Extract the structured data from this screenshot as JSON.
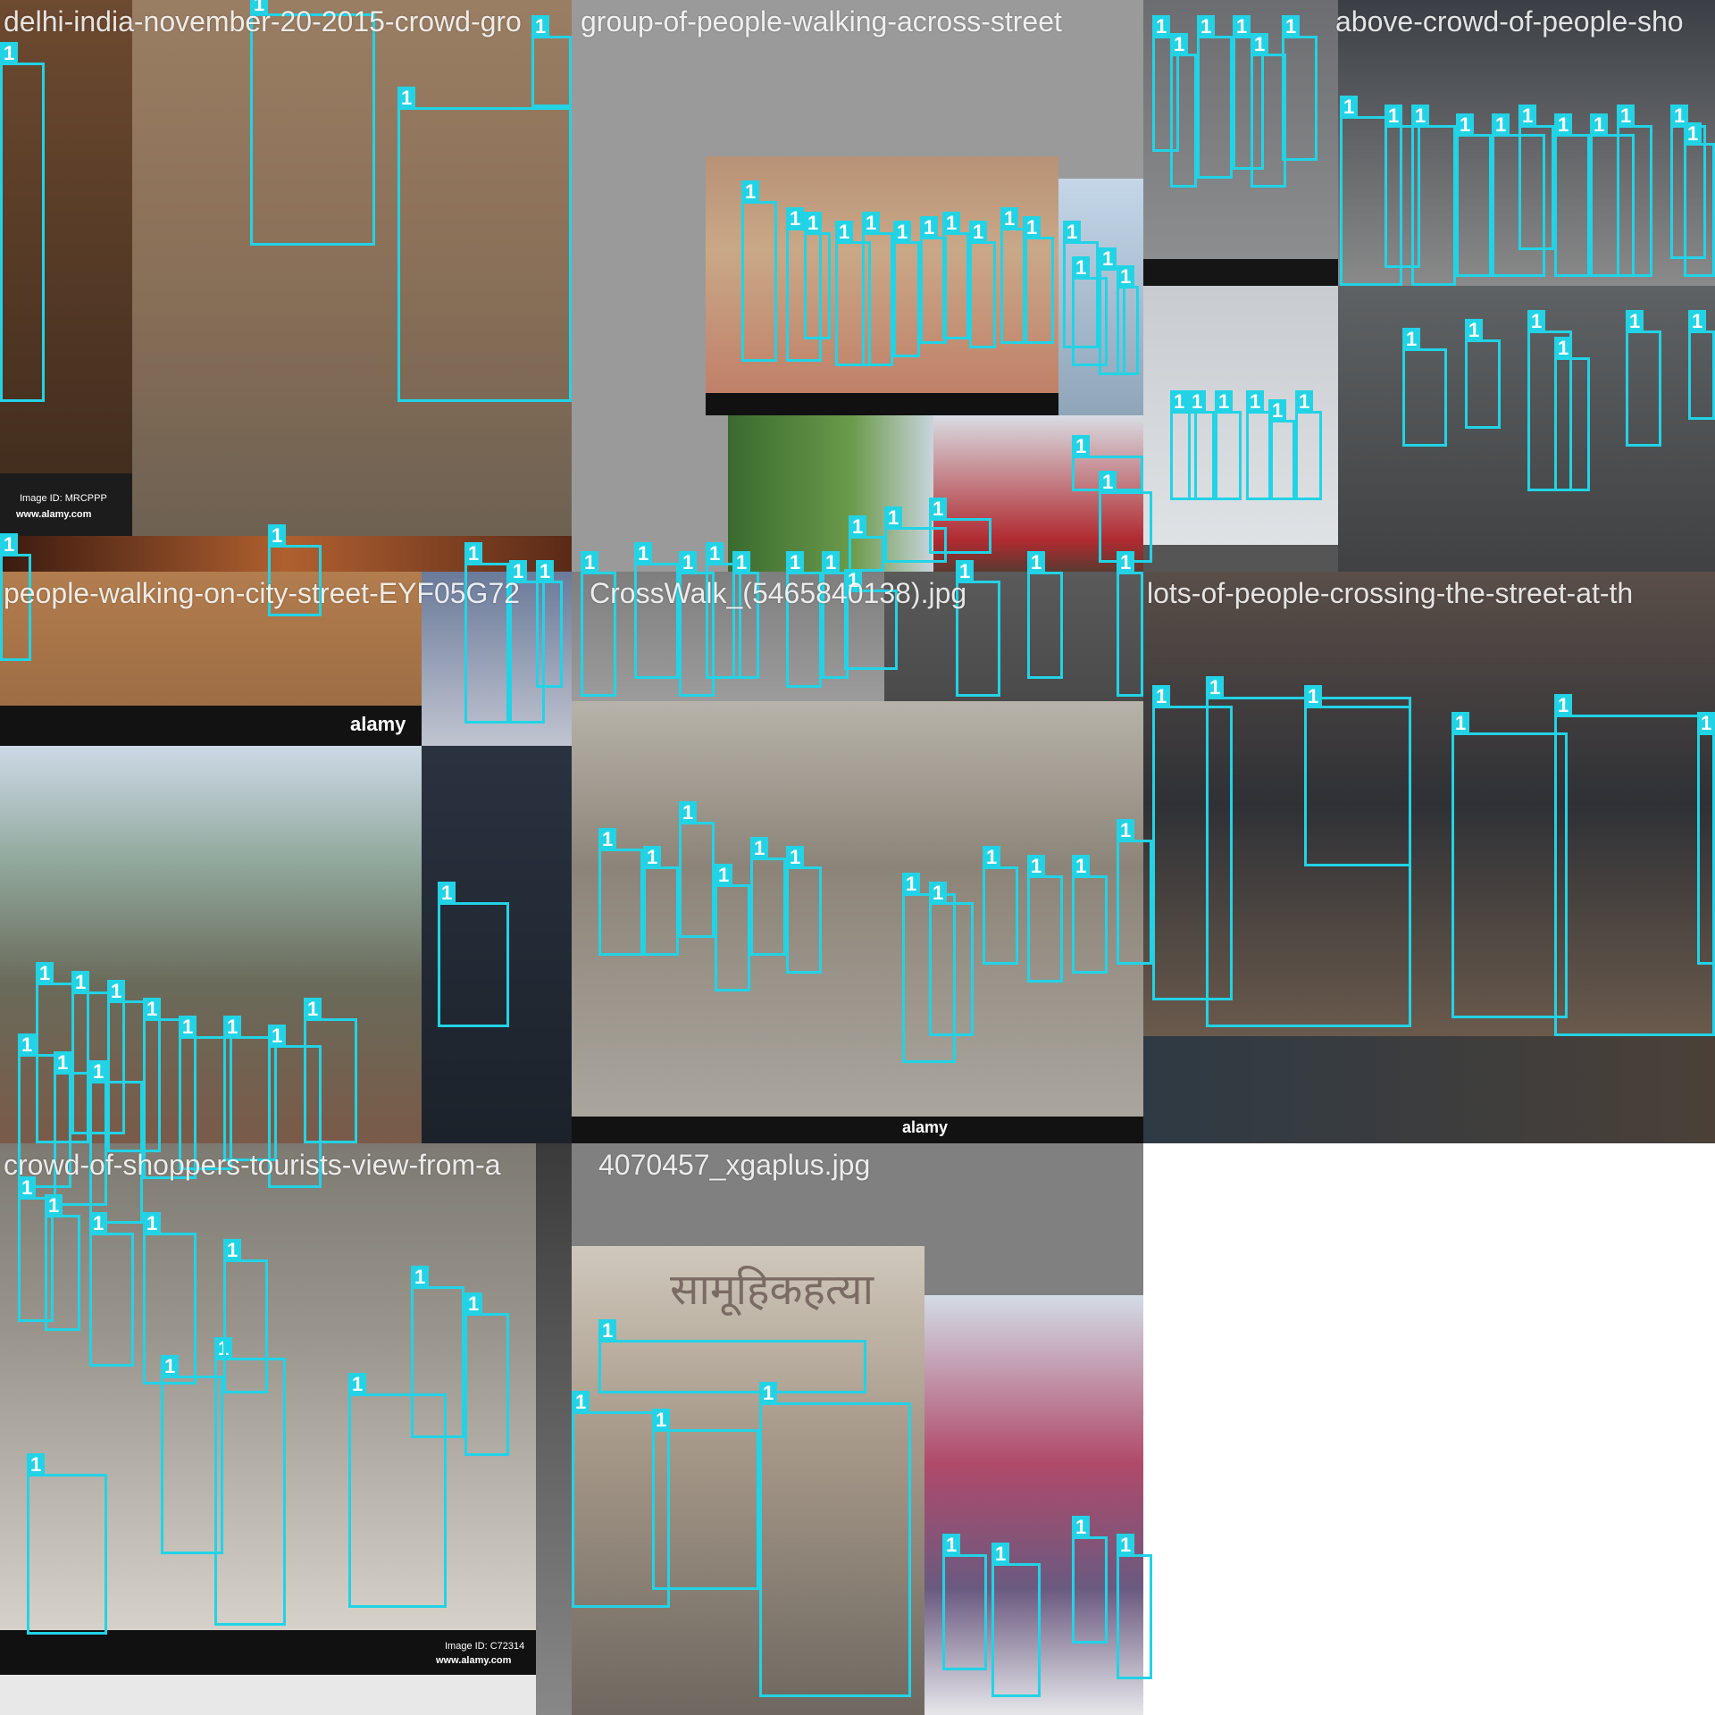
{
  "label_text": "1",
  "box_color": "#22d3e6",
  "tiles": [
    {
      "title": "delhi-india-november-20-2015-crowd-gro"
    },
    {
      "title": "group-of-people-walking-across-street"
    },
    {
      "title": "above-crowd-of-people-sho"
    },
    {
      "title": "people-walking-on-city-street-EYF05G72"
    },
    {
      "title": "CrossWalk_(5465840138).jpg"
    },
    {
      "title": "lots-of-people-crossing-the-street-at-th"
    },
    {
      "title": "crowd-of-shoppers-tourists-view-from-a"
    },
    {
      "title": "4070457_xgaplus.jpg"
    }
  ],
  "watermarks": {
    "image_id_1": "Image ID: MRCPPP",
    "site_1": "www.alamy.com",
    "image_id_2": "Image ID: C72314",
    "site_2": "www.alamy.com",
    "brand": "alamy",
    "devanagari_text": "सामूहिकहत्या"
  }
}
